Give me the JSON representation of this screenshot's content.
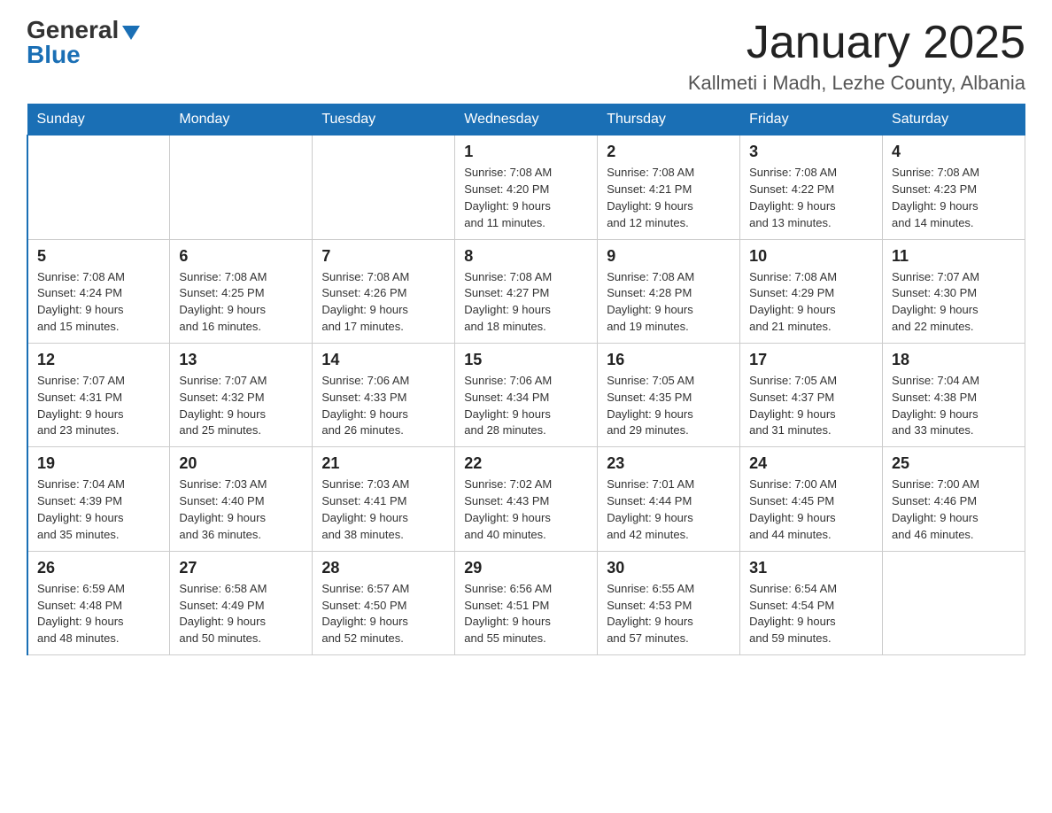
{
  "header": {
    "logo_general": "General",
    "logo_blue": "Blue",
    "month_title": "January 2025",
    "location": "Kallmeti i Madh, Lezhe County, Albania"
  },
  "days_of_week": [
    "Sunday",
    "Monday",
    "Tuesday",
    "Wednesday",
    "Thursday",
    "Friday",
    "Saturday"
  ],
  "weeks": [
    [
      {
        "day": "",
        "info": ""
      },
      {
        "day": "",
        "info": ""
      },
      {
        "day": "",
        "info": ""
      },
      {
        "day": "1",
        "info": "Sunrise: 7:08 AM\nSunset: 4:20 PM\nDaylight: 9 hours\nand 11 minutes."
      },
      {
        "day": "2",
        "info": "Sunrise: 7:08 AM\nSunset: 4:21 PM\nDaylight: 9 hours\nand 12 minutes."
      },
      {
        "day": "3",
        "info": "Sunrise: 7:08 AM\nSunset: 4:22 PM\nDaylight: 9 hours\nand 13 minutes."
      },
      {
        "day": "4",
        "info": "Sunrise: 7:08 AM\nSunset: 4:23 PM\nDaylight: 9 hours\nand 14 minutes."
      }
    ],
    [
      {
        "day": "5",
        "info": "Sunrise: 7:08 AM\nSunset: 4:24 PM\nDaylight: 9 hours\nand 15 minutes."
      },
      {
        "day": "6",
        "info": "Sunrise: 7:08 AM\nSunset: 4:25 PM\nDaylight: 9 hours\nand 16 minutes."
      },
      {
        "day": "7",
        "info": "Sunrise: 7:08 AM\nSunset: 4:26 PM\nDaylight: 9 hours\nand 17 minutes."
      },
      {
        "day": "8",
        "info": "Sunrise: 7:08 AM\nSunset: 4:27 PM\nDaylight: 9 hours\nand 18 minutes."
      },
      {
        "day": "9",
        "info": "Sunrise: 7:08 AM\nSunset: 4:28 PM\nDaylight: 9 hours\nand 19 minutes."
      },
      {
        "day": "10",
        "info": "Sunrise: 7:08 AM\nSunset: 4:29 PM\nDaylight: 9 hours\nand 21 minutes."
      },
      {
        "day": "11",
        "info": "Sunrise: 7:07 AM\nSunset: 4:30 PM\nDaylight: 9 hours\nand 22 minutes."
      }
    ],
    [
      {
        "day": "12",
        "info": "Sunrise: 7:07 AM\nSunset: 4:31 PM\nDaylight: 9 hours\nand 23 minutes."
      },
      {
        "day": "13",
        "info": "Sunrise: 7:07 AM\nSunset: 4:32 PM\nDaylight: 9 hours\nand 25 minutes."
      },
      {
        "day": "14",
        "info": "Sunrise: 7:06 AM\nSunset: 4:33 PM\nDaylight: 9 hours\nand 26 minutes."
      },
      {
        "day": "15",
        "info": "Sunrise: 7:06 AM\nSunset: 4:34 PM\nDaylight: 9 hours\nand 28 minutes."
      },
      {
        "day": "16",
        "info": "Sunrise: 7:05 AM\nSunset: 4:35 PM\nDaylight: 9 hours\nand 29 minutes."
      },
      {
        "day": "17",
        "info": "Sunrise: 7:05 AM\nSunset: 4:37 PM\nDaylight: 9 hours\nand 31 minutes."
      },
      {
        "day": "18",
        "info": "Sunrise: 7:04 AM\nSunset: 4:38 PM\nDaylight: 9 hours\nand 33 minutes."
      }
    ],
    [
      {
        "day": "19",
        "info": "Sunrise: 7:04 AM\nSunset: 4:39 PM\nDaylight: 9 hours\nand 35 minutes."
      },
      {
        "day": "20",
        "info": "Sunrise: 7:03 AM\nSunset: 4:40 PM\nDaylight: 9 hours\nand 36 minutes."
      },
      {
        "day": "21",
        "info": "Sunrise: 7:03 AM\nSunset: 4:41 PM\nDaylight: 9 hours\nand 38 minutes."
      },
      {
        "day": "22",
        "info": "Sunrise: 7:02 AM\nSunset: 4:43 PM\nDaylight: 9 hours\nand 40 minutes."
      },
      {
        "day": "23",
        "info": "Sunrise: 7:01 AM\nSunset: 4:44 PM\nDaylight: 9 hours\nand 42 minutes."
      },
      {
        "day": "24",
        "info": "Sunrise: 7:00 AM\nSunset: 4:45 PM\nDaylight: 9 hours\nand 44 minutes."
      },
      {
        "day": "25",
        "info": "Sunrise: 7:00 AM\nSunset: 4:46 PM\nDaylight: 9 hours\nand 46 minutes."
      }
    ],
    [
      {
        "day": "26",
        "info": "Sunrise: 6:59 AM\nSunset: 4:48 PM\nDaylight: 9 hours\nand 48 minutes."
      },
      {
        "day": "27",
        "info": "Sunrise: 6:58 AM\nSunset: 4:49 PM\nDaylight: 9 hours\nand 50 minutes."
      },
      {
        "day": "28",
        "info": "Sunrise: 6:57 AM\nSunset: 4:50 PM\nDaylight: 9 hours\nand 52 minutes."
      },
      {
        "day": "29",
        "info": "Sunrise: 6:56 AM\nSunset: 4:51 PM\nDaylight: 9 hours\nand 55 minutes."
      },
      {
        "day": "30",
        "info": "Sunrise: 6:55 AM\nSunset: 4:53 PM\nDaylight: 9 hours\nand 57 minutes."
      },
      {
        "day": "31",
        "info": "Sunrise: 6:54 AM\nSunset: 4:54 PM\nDaylight: 9 hours\nand 59 minutes."
      },
      {
        "day": "",
        "info": ""
      }
    ]
  ]
}
